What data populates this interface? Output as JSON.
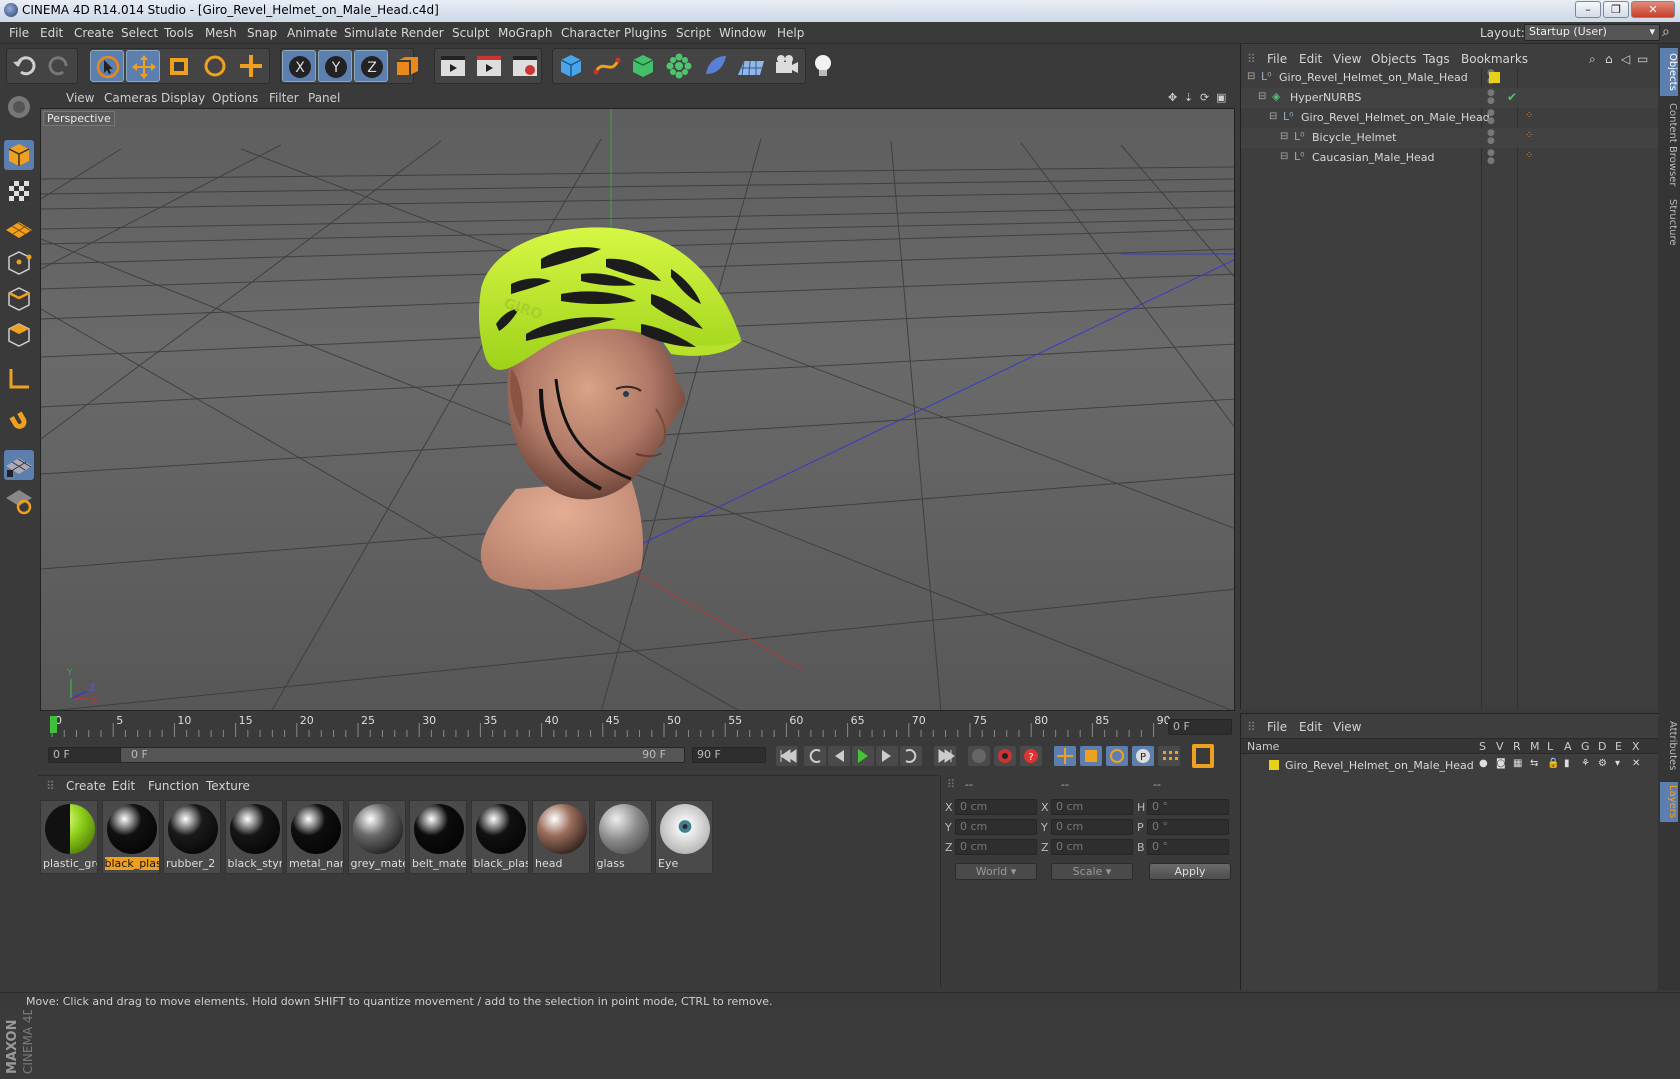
{
  "window": {
    "title": "CINEMA 4D R14.014 Studio - [Giro_Revel_Helmet_on_Male_Head.c4d]",
    "buttons": [
      "–",
      "❐",
      "✕"
    ]
  },
  "menubar": {
    "items": [
      "File",
      "Edit",
      "Create",
      "Select",
      "Tools",
      "Mesh",
      "Snap",
      "Animate",
      "Simulate",
      "Render",
      "Sculpt",
      "MoGraph",
      "Character",
      "Plugins",
      "Script",
      "Window",
      "Help"
    ],
    "layout_label": "Layout:",
    "layout_value": "Startup (User)"
  },
  "toolbar": {
    "icons": [
      "undo-icon",
      "redo-icon",
      "live-select-icon",
      "move-icon",
      "scale-icon",
      "rotate-icon",
      "add-icon",
      "x-axis-icon",
      "y-axis-icon",
      "z-axis-icon",
      "coordinate-system-icon",
      "render-view-icon",
      "render-picture-viewer-icon",
      "render-settings-icon",
      "cube-icon",
      "spline-pen-icon",
      "nurbs-icon",
      "array-icon",
      "deformer-icon",
      "floor-icon",
      "camera-icon",
      "light-icon"
    ]
  },
  "viewport": {
    "menu": [
      "View",
      "Cameras",
      "Display",
      "Options",
      "Filter",
      "Panel"
    ],
    "label": "Perspective",
    "axis": {
      "x": "X",
      "y": "Y",
      "z": "Z"
    }
  },
  "timeline": {
    "ticks": [
      "0",
      "5",
      "10",
      "15",
      "20",
      "25",
      "30",
      "35",
      "40",
      "45",
      "50",
      "55",
      "60",
      "65",
      "70",
      "75",
      "80",
      "85",
      "90"
    ],
    "current_frame": "0 F",
    "start_field": "0 F",
    "range_start": "0 F",
    "range_end": "90 F",
    "end_field": "90 F"
  },
  "materials": {
    "menu": [
      "Create",
      "Edit",
      "Function",
      "Texture"
    ],
    "items": [
      {
        "name": "plastic_gre",
        "color": "#8fd11c"
      },
      {
        "name": "black_plast",
        "color": "#111111",
        "selected": true
      },
      {
        "name": "rubber_2",
        "color": "#1a1a1a"
      },
      {
        "name": "black_styro",
        "color": "#151515"
      },
      {
        "name": "metal_nam",
        "color": "#0e0e0e"
      },
      {
        "name": "grey_mater",
        "color": "#6a6a6a"
      },
      {
        "name": "belt_materi",
        "color": "#0c0c0c"
      },
      {
        "name": "black_plast",
        "color": "#111111"
      },
      {
        "name": "head",
        "color": "#9a6d5b"
      },
      {
        "name": "glass",
        "color": "#8a8a8a"
      },
      {
        "name": "Eye",
        "color": "#e0e0e0"
      }
    ]
  },
  "coordinates": {
    "headers": [
      "--",
      "--",
      "--"
    ],
    "rows": [
      {
        "a": "X",
        "av": "0 cm",
        "b": "X",
        "bv": "0 cm",
        "c": "H",
        "cv": "0 °"
      },
      {
        "a": "Y",
        "av": "0 cm",
        "b": "Y",
        "bv": "0 cm",
        "c": "P",
        "cv": "0 °"
      },
      {
        "a": "Z",
        "av": "0 cm",
        "b": "Z",
        "bv": "0 cm",
        "c": "B",
        "cv": "0 °"
      }
    ],
    "world": "World",
    "scale": "Scale",
    "apply": "Apply"
  },
  "object_manager": {
    "menu": [
      "File",
      "Edit",
      "View",
      "Objects",
      "Tags",
      "Bookmarks"
    ],
    "objects": [
      {
        "name": "Giro_Revel_Helmet_on_Male_Head",
        "indent": 0
      },
      {
        "name": "HyperNURBS",
        "indent": 1
      },
      {
        "name": "Giro_Revel_Helmet_on_Male_Head",
        "indent": 2
      },
      {
        "name": "Bicycle_Helmet",
        "indent": 3
      },
      {
        "name": "Caucasian_Male_Head",
        "indent": 3
      }
    ]
  },
  "layer_manager": {
    "menu": [
      "File",
      "Edit",
      "View"
    ],
    "headers": [
      "Name",
      "S",
      "V",
      "R",
      "M",
      "L",
      "A",
      "G",
      "D",
      "E",
      "X"
    ],
    "layers": [
      {
        "name": "Giro_Revel_Helmet_on_Male_Head",
        "color": "#e6d21a"
      }
    ]
  },
  "side_tabs": [
    "Objects",
    "Content Browser",
    "Structure",
    "Attributes",
    "Layers"
  ],
  "status": "Move: Click and drag to move elements. Hold down SHIFT to quantize movement / add to the selection in point mode, CTRL to remove.",
  "brand": "MAXON CINEMA 4D"
}
